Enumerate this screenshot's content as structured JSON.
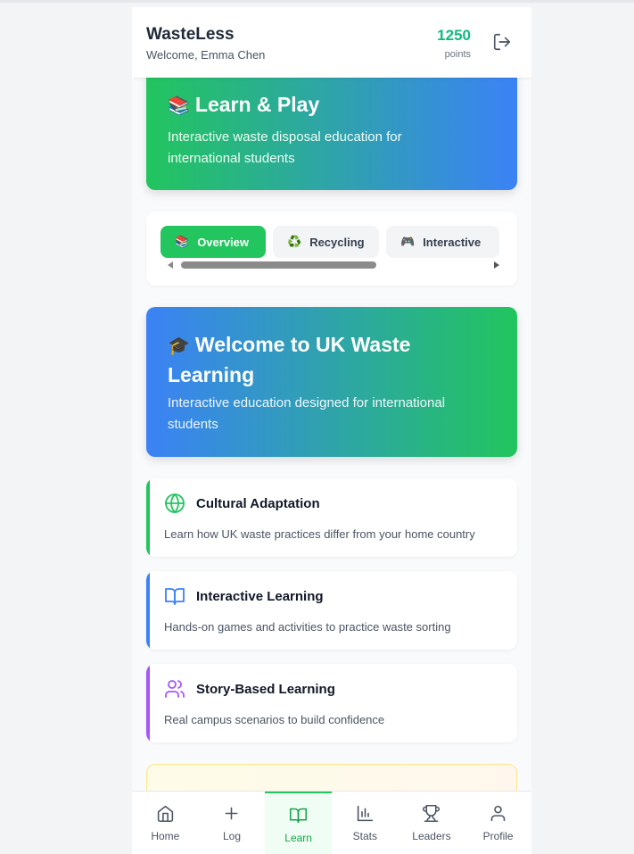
{
  "header": {
    "app_name": "WasteLess",
    "welcome": "Welcome, Emma Chen",
    "points": "1250",
    "points_label": "points"
  },
  "hero_learn": {
    "emoji": "📚",
    "title": "Learn & Play",
    "subtitle": "Interactive waste disposal education for international students"
  },
  "tabs": [
    {
      "icon": "📚",
      "label": "Overview",
      "active": true
    },
    {
      "icon": "♻️",
      "label": "Recycling",
      "active": false
    },
    {
      "icon": "🎮",
      "label": "Interactive",
      "active": false
    }
  ],
  "hero_welcome": {
    "emoji": "🎓",
    "title": "Welcome to UK Waste Learning",
    "subtitle": "Interactive education designed for international students"
  },
  "features": [
    {
      "icon": "globe-icon",
      "title": "Cultural Adaptation",
      "desc": "Learn how UK waste practices differ from your home country",
      "color": "#22c55e"
    },
    {
      "icon": "book-icon",
      "title": "Interactive Learning",
      "desc": "Hands-on games and activities to practice waste sorting",
      "color": "#3b82f6"
    },
    {
      "icon": "users-icon",
      "title": "Story-Based Learning",
      "desc": "Real campus scenarios to build confidence",
      "color": "#a855f7"
    }
  ],
  "nav": [
    {
      "icon": "home-icon",
      "label": "Home"
    },
    {
      "icon": "plus-icon",
      "label": "Log"
    },
    {
      "icon": "book-icon",
      "label": "Learn",
      "active": true
    },
    {
      "icon": "stats-icon",
      "label": "Stats"
    },
    {
      "icon": "trophy-icon",
      "label": "Leaders"
    },
    {
      "icon": "profile-icon",
      "label": "Profile"
    }
  ],
  "colors": {
    "primary": "#22c55e",
    "blue": "#3b82f6",
    "purple": "#a855f7",
    "points": "#10b981"
  }
}
